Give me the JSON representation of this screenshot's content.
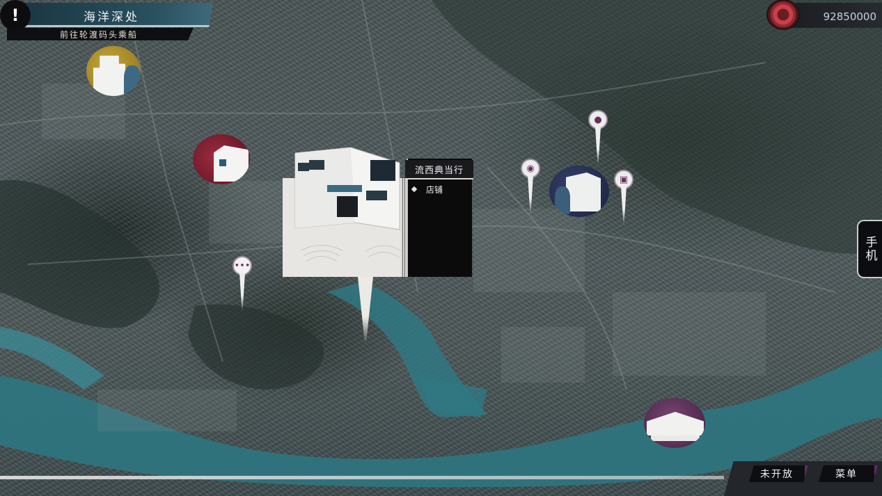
{
  "quest": {
    "alert_icon": "exclamation-icon",
    "title": "海洋深处",
    "subtitle": "前往轮渡码头乘船"
  },
  "currency": {
    "icon": "coin-icon",
    "amount": "92850000"
  },
  "side_tab": {
    "label": "手机"
  },
  "selected_location": {
    "name": "流西典当行",
    "options": [
      "店铺"
    ]
  },
  "map_pins": [
    {
      "icon": "camera-icon"
    },
    {
      "icon": "dog-icon"
    },
    {
      "icon": "cctv-camera-icon"
    },
    {
      "icon": "chat-bubble-icon"
    }
  ],
  "bottom_buttons": {
    "not_open": "未开放",
    "menu": "菜单"
  },
  "colors": {
    "water": "#2f7a85",
    "marker_gold": "#b89a2a",
    "marker_red": "#8e2236",
    "marker_navy": "#2a3358",
    "marker_purple": "#6b3a6a",
    "accent_purple": "#5d2a6a"
  }
}
